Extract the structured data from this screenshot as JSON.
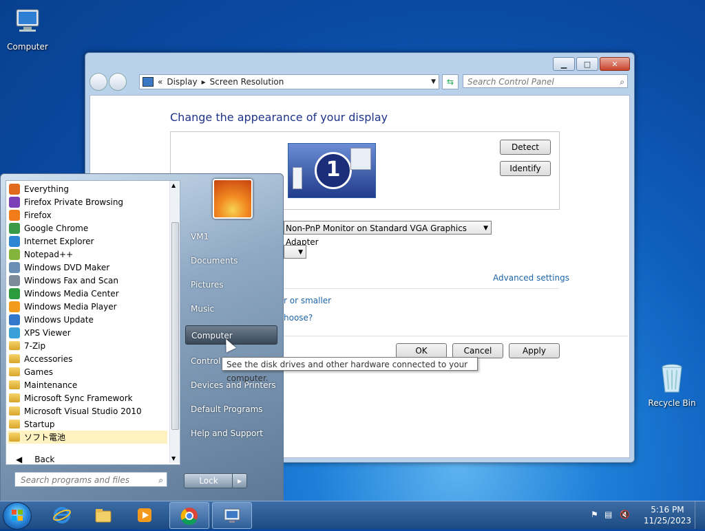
{
  "desktop": {
    "computer_label": "Computer",
    "recycle_label": "Recycle Bin"
  },
  "window": {
    "address": {
      "prefix": "«",
      "crumb1": "Display",
      "crumb2": "Screen Resolution"
    },
    "search_placeholder": "Search Control Panel",
    "heading": "Change the appearance of your display",
    "monitor_number": "1",
    "detect_label": "Detect",
    "identify_label": "Identify",
    "display_value": "Non-PnP Monitor on Standard VGA Graphics Adapter",
    "advanced_link": "Advanced settings",
    "link_larger": "r or smaller",
    "link_choose": "hoose?",
    "ok_label": "OK",
    "cancel_label": "Cancel",
    "apply_label": "Apply"
  },
  "start_menu": {
    "programs": [
      {
        "label": "Everything",
        "icon": "everything-icon",
        "color": "#e06a1e"
      },
      {
        "label": "Firefox Private Browsing",
        "icon": "firefox-private-icon",
        "color": "#7b3fb8"
      },
      {
        "label": "Firefox",
        "icon": "firefox-icon",
        "color": "#f27c1a"
      },
      {
        "label": "Google Chrome",
        "icon": "chrome-icon",
        "color": "#3a9a47"
      },
      {
        "label": "Internet Explorer",
        "icon": "ie-icon",
        "color": "#2d86d3"
      },
      {
        "label": "Notepad++",
        "icon": "notepad-icon",
        "color": "#84b43c"
      },
      {
        "label": "Windows DVD Maker",
        "icon": "dvd-icon",
        "color": "#6b8fb5"
      },
      {
        "label": "Windows Fax and Scan",
        "icon": "fax-icon",
        "color": "#7c8a99"
      },
      {
        "label": "Windows Media Center",
        "icon": "media-center-icon",
        "color": "#2b9b3d"
      },
      {
        "label": "Windows Media Player",
        "icon": "media-player-icon",
        "color": "#f29a1c"
      },
      {
        "label": "Windows Update",
        "icon": "update-icon",
        "color": "#3377cc"
      },
      {
        "label": "XPS Viewer",
        "icon": "xps-icon",
        "color": "#3aa0d8"
      },
      {
        "label": "7-Zip",
        "icon": "folder-icon",
        "color": "folder"
      },
      {
        "label": "Accessories",
        "icon": "folder-icon",
        "color": "folder"
      },
      {
        "label": "Games",
        "icon": "folder-icon",
        "color": "folder"
      },
      {
        "label": "Maintenance",
        "icon": "folder-icon",
        "color": "folder"
      },
      {
        "label": "Microsoft Sync Framework",
        "icon": "folder-icon",
        "color": "folder"
      },
      {
        "label": "Microsoft Visual Studio 2010",
        "icon": "folder-icon",
        "color": "folder"
      },
      {
        "label": "Startup",
        "icon": "folder-icon",
        "color": "folder"
      },
      {
        "label": "ソフト電池",
        "icon": "folder-icon",
        "color": "folder"
      }
    ],
    "back_label": "Back",
    "search_placeholder": "Search programs and files",
    "right_items": [
      "VM1",
      "Documents",
      "Pictures",
      "Music",
      "Computer",
      "Control Panel",
      "Devices and Printers",
      "Default Programs",
      "Help and Support"
    ],
    "lock_label": "Lock"
  },
  "tooltip": "See the disk drives and other hardware connected to your computer.",
  "taskbar": {
    "time": "5:16 PM",
    "date": "11/25/2023"
  }
}
